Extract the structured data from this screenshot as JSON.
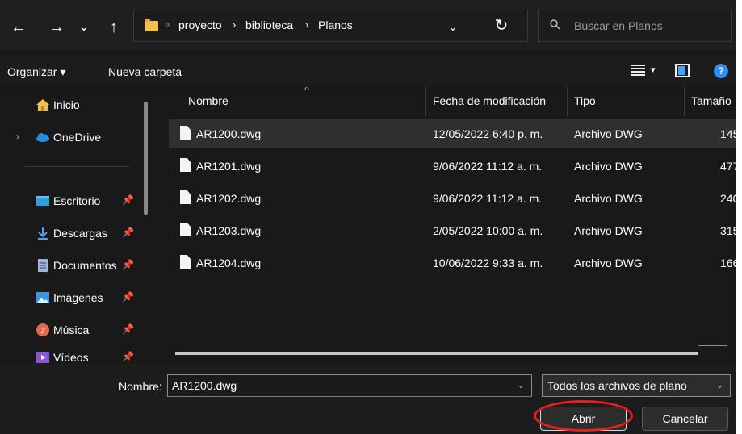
{
  "nav": {
    "back": "←",
    "forward": "→",
    "history": "⌄",
    "up": "↑"
  },
  "address": {
    "overflow": "«",
    "crumbs": [
      "proyecto",
      "biblioteca",
      "Planos"
    ],
    "separator": "›",
    "dropdown": "⌄",
    "refresh": "↻"
  },
  "search": {
    "placeholder": "Buscar en Planos"
  },
  "toolbar": {
    "organize": "Organizar ▾",
    "new_folder": "Nueva carpeta",
    "view_dropdown": "▾",
    "help": "?"
  },
  "sidebar": {
    "items": [
      {
        "label": "Inicio",
        "icon": "home-icon",
        "pinned": false
      },
      {
        "label": "OneDrive",
        "icon": "cloud-icon",
        "pinned": false,
        "expandable": true
      },
      {
        "label": "Escritorio",
        "icon": "desktop-icon",
        "pinned": true
      },
      {
        "label": "Descargas",
        "icon": "download-icon",
        "pinned": true
      },
      {
        "label": "Documentos",
        "icon": "document-icon",
        "pinned": true
      },
      {
        "label": "Imágenes",
        "icon": "pictures-icon",
        "pinned": true
      },
      {
        "label": "Música",
        "icon": "music-icon",
        "pinned": true
      },
      {
        "label": "Vídeos",
        "icon": "video-icon",
        "pinned": true
      }
    ],
    "pin_glyph": "📌",
    "expand_glyph": "›"
  },
  "columns": {
    "name": "Nombre",
    "modified": "Fecha de modificación",
    "type": "Tipo",
    "size": "Tamaño",
    "sort_caret": "^"
  },
  "files": [
    {
      "name": "AR1200.dwg",
      "modified": "12/05/2022 6:40 p. m.",
      "type": "Archivo DWG",
      "size": "145",
      "selected": true
    },
    {
      "name": "AR1201.dwg",
      "modified": "9/06/2022 11:12 a. m.",
      "type": "Archivo DWG",
      "size": "477",
      "selected": false
    },
    {
      "name": "AR1202.dwg",
      "modified": "9/06/2022 11:12 a. m.",
      "type": "Archivo DWG",
      "size": "240",
      "selected": false
    },
    {
      "name": "AR1203.dwg",
      "modified": "2/05/2022 10:00 a. m.",
      "type": "Archivo DWG",
      "size": "315",
      "selected": false
    },
    {
      "name": "AR1204.dwg",
      "modified": "10/06/2022 9:33 a. m.",
      "type": "Archivo DWG",
      "size": "166",
      "selected": false
    }
  ],
  "footer": {
    "name_label": "Nombre:",
    "name_value": "AR1200.dwg",
    "type_value": "Todos los archivos de plano",
    "dropdown": "⌄",
    "open": "Abrir",
    "cancel": "Cancelar"
  },
  "colors": {
    "background": "#191919",
    "selected_row": "#2f2f2f",
    "highlight_circle": "#e32020",
    "folder": "#f2c14e"
  }
}
